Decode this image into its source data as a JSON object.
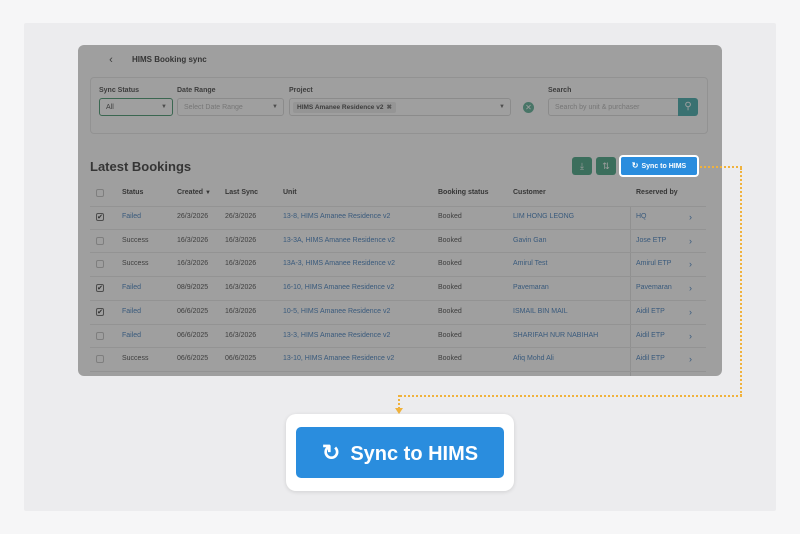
{
  "header": {
    "back_icon": "chevron-left-icon",
    "title": "HIMS Booking sync"
  },
  "filters": {
    "sync_status": {
      "label": "Sync Status",
      "value": "All"
    },
    "date_range": {
      "label": "Date Range",
      "placeholder": "Select Date Range"
    },
    "project": {
      "label": "Project",
      "chip": "HIMS Amanee Residence v2"
    },
    "search": {
      "label": "Search",
      "placeholder": "Search by unit & purchaser"
    }
  },
  "section": {
    "title": "Latest Bookings"
  },
  "toolbar": {
    "download_icon": "download-icon",
    "sort_icon": "sort-icon",
    "sync_label": "Sync to HIMS"
  },
  "table": {
    "headers": [
      "Status",
      "Created",
      "Last Sync",
      "Unit",
      "Booking status",
      "Customer",
      "Reserved by"
    ],
    "rows": [
      {
        "checked": true,
        "status": "Failed",
        "created": "26/3/2026",
        "last_sync": "26/3/2026",
        "unit": "13-8, HIMS Amanee Residence v2",
        "booking_status": "Booked",
        "customer": "LIM HONG LEONG",
        "reserved_by": "HQ"
      },
      {
        "checked": false,
        "status": "Success",
        "created": "16/3/2026",
        "last_sync": "16/3/2026",
        "unit": "13-3A, HIMS Amanee Residence v2",
        "booking_status": "Booked",
        "customer": "Gavin Gan",
        "reserved_by": "Jose ETP"
      },
      {
        "checked": false,
        "status": "Success",
        "created": "16/3/2026",
        "last_sync": "16/3/2026",
        "unit": "13A-3, HIMS Amanee Residence v2",
        "booking_status": "Booked",
        "customer": "Amirul Test",
        "reserved_by": "Amirul ETP"
      },
      {
        "checked": true,
        "status": "Failed",
        "created": "08/9/2025",
        "last_sync": "16/3/2026",
        "unit": "16-10, HIMS Amanee Residence v2",
        "booking_status": "Booked",
        "customer": "Pavemaran",
        "reserved_by": "Pavemaran"
      },
      {
        "checked": true,
        "status": "Failed",
        "created": "06/6/2025",
        "last_sync": "16/3/2026",
        "unit": "10-5, HIMS Amanee Residence v2",
        "booking_status": "Booked",
        "customer": "ISMAIL BIN MAIL",
        "reserved_by": "Aidil ETP"
      },
      {
        "checked": false,
        "status": "Failed",
        "created": "06/6/2025",
        "last_sync": "16/3/2026",
        "unit": "13-3, HIMS Amanee Residence v2",
        "booking_status": "Booked",
        "customer": "SHARIFAH NUR NABIHAH",
        "reserved_by": "Aidil ETP"
      },
      {
        "checked": false,
        "status": "Success",
        "created": "06/6/2025",
        "last_sync": "06/6/2025",
        "unit": "13-10, HIMS Amanee Residence v2",
        "booking_status": "Booked",
        "customer": "Afiq Mohd Ali",
        "reserved_by": "Aidil ETP"
      }
    ]
  },
  "callout": {
    "sync_label": "Sync to HIMS",
    "icon": "refresh-icon"
  },
  "colors": {
    "accent": "#2a8dde",
    "highlight_dots": "#f0b23c",
    "green": "#2f9a73"
  }
}
